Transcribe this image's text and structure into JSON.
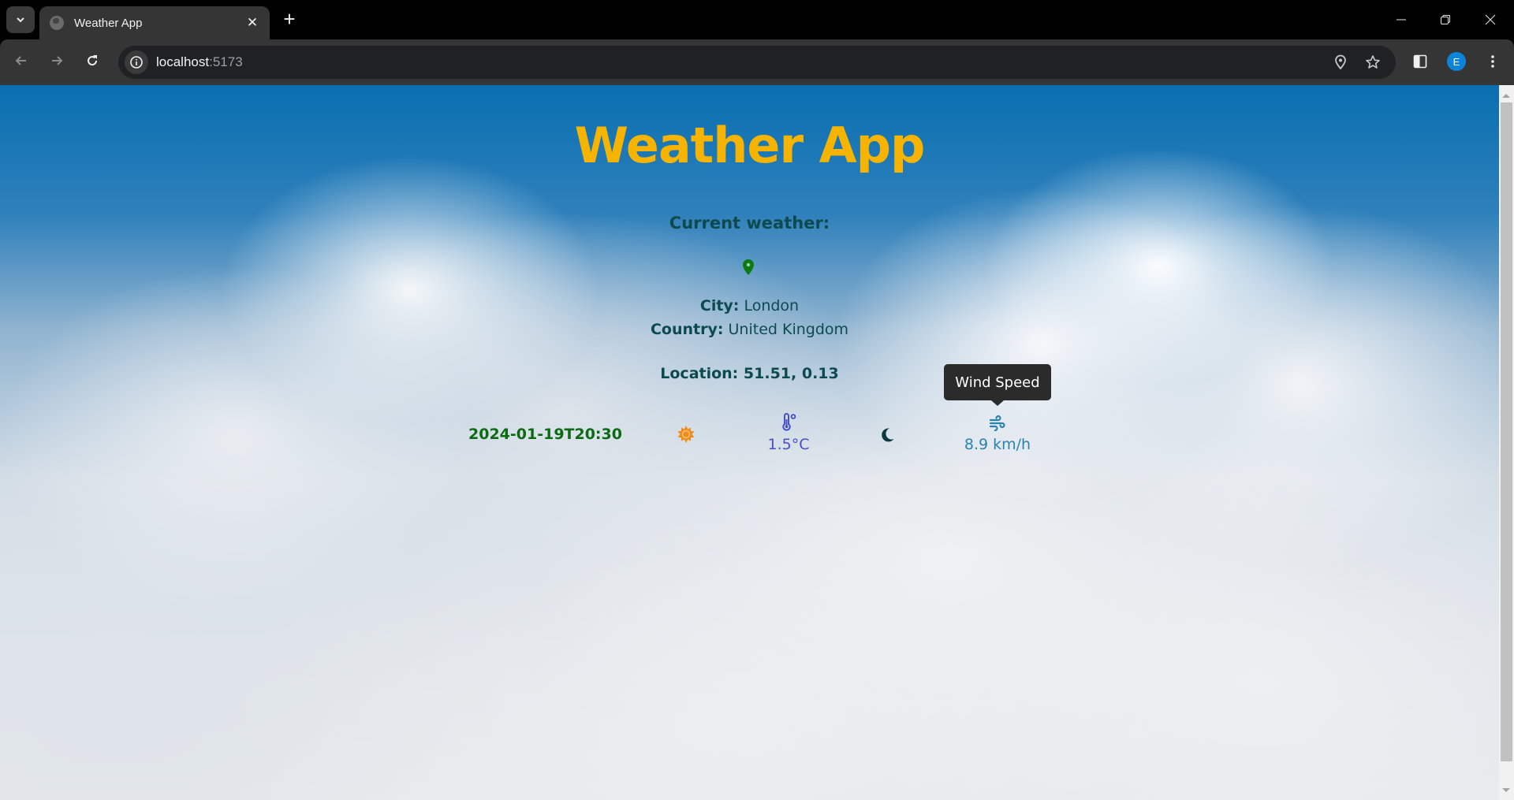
{
  "browser": {
    "tab_title": "Weather App",
    "url_host": "localhost",
    "url_port": ":5173",
    "profile_initial": "E"
  },
  "app": {
    "title": "Weather App",
    "subtitle": "Current weather:",
    "city_label": "City:",
    "city_value": "London",
    "country_label": "Country:",
    "country_value": "United Kingdom",
    "location_label": "Location:",
    "location_value": "51.51, 0.13",
    "datetime": "2024-01-19T20:30",
    "temperature": "1.5°C",
    "wind_speed": "8.9 km/h",
    "tooltip": "Wind Speed",
    "icons": {
      "location": "map-pin-icon",
      "day_indicator": "sun-icon",
      "temperature": "thermometer-icon",
      "night_indicator": "moon-icon",
      "wind": "wind-icon"
    }
  },
  "colors": {
    "title": "#f6b400",
    "text_dark": "#0c4a4f",
    "date_green": "#0c6b12",
    "pin_green": "#0b7a12",
    "sun_orange": "#f08c1a",
    "temperature_blue": "#4a4fc7",
    "wind_teal": "#2a83ad",
    "moon_dark": "#0b3a44"
  }
}
